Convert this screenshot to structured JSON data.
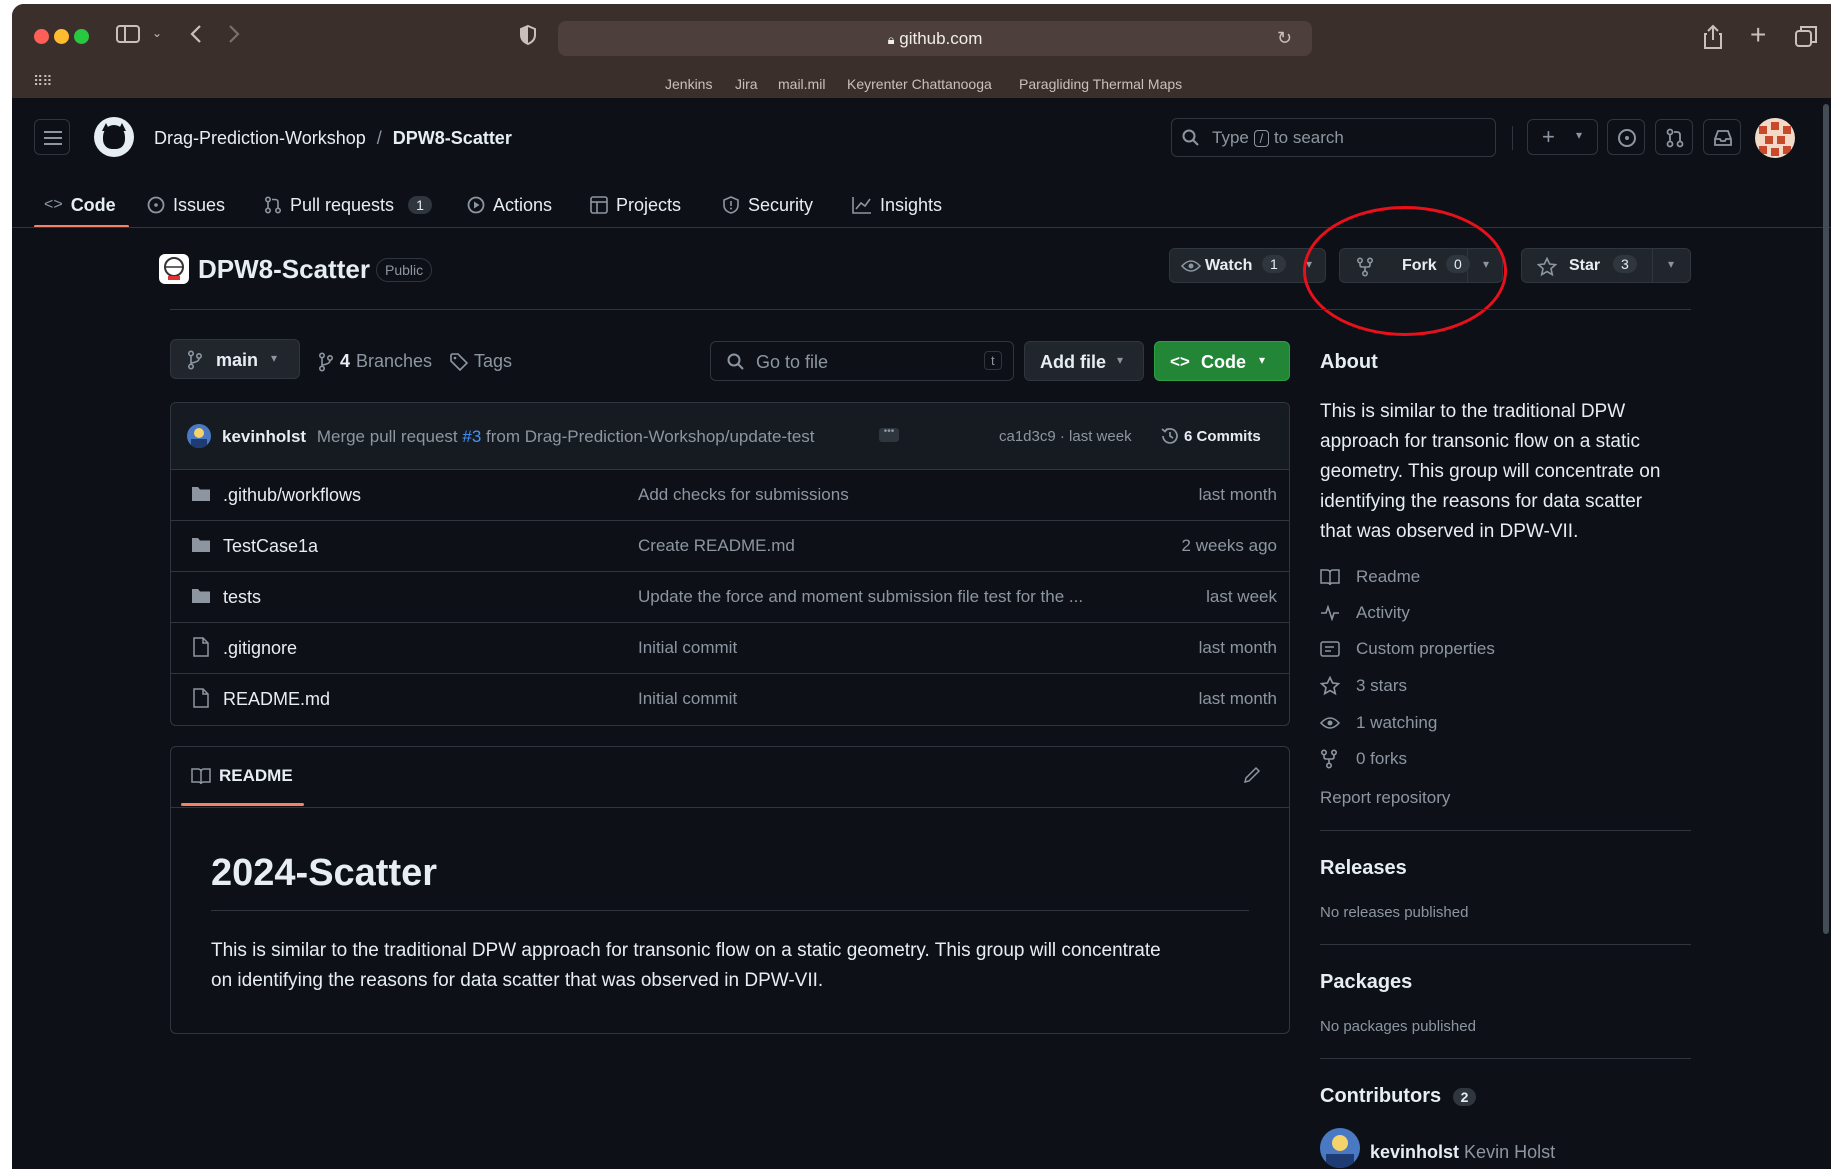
{
  "browser": {
    "url": "github.com",
    "favorites": [
      "Jenkins",
      "Jira",
      "mail.mil",
      "Keyrenter Chattanooga",
      "Paragliding Thermal Maps"
    ]
  },
  "header": {
    "owner": "Drag-Prediction-Workshop",
    "separator": "/",
    "repo": "DPW8-Scatter",
    "search_prefix": "Type",
    "search_key": "/",
    "search_suffix": "to search"
  },
  "nav": {
    "code": "Code",
    "issues": "Issues",
    "pulls": "Pull requests",
    "pulls_count": "1",
    "actions": "Actions",
    "projects": "Projects",
    "security": "Security",
    "insights": "Insights"
  },
  "repo": {
    "name": "DPW8-Scatter",
    "visibility": "Public",
    "watch_label": "Watch",
    "watch_count": "1",
    "fork_label": "Fork",
    "fork_count": "0",
    "star_label": "Star",
    "star_count": "3"
  },
  "toolbar": {
    "branch": "main",
    "branches_count": "4",
    "branches_label": "Branches",
    "tags_label": "Tags",
    "go_to_file": "Go to file",
    "go_to_file_key": "t",
    "add_file": "Add file",
    "code_button": "Code"
  },
  "commit": {
    "author": "kevinholst",
    "message_prefix": "Merge pull request",
    "pr_link": "#3",
    "message_suffix": "from Drag-Prediction-Workshop/update-test",
    "hash_time": "ca1d3c9 · last week",
    "commits_label": "6 Commits"
  },
  "files": [
    {
      "name": ".github/workflows",
      "type": "folder",
      "message": "Add checks for submissions",
      "time": "last month"
    },
    {
      "name": "TestCase1a",
      "type": "folder",
      "message": "Create README.md",
      "time": "2 weeks ago"
    },
    {
      "name": "tests",
      "type": "folder",
      "message": "Update the force and moment submission file test for the ...",
      "time": "last week"
    },
    {
      "name": ".gitignore",
      "type": "file",
      "message": "Initial commit",
      "time": "last month"
    },
    {
      "name": "README.md",
      "type": "file",
      "message": "Initial commit",
      "time": "last month"
    }
  ],
  "readme": {
    "tab_label": "README",
    "heading": "2024-Scatter",
    "body_line1": "This is similar to the traditional DPW approach for transonic flow on a static geometry. This group will concentrate",
    "body_line2": "on identifying the reasons for data scatter that was observed in DPW-VII."
  },
  "about": {
    "title": "About",
    "desc_lines": [
      "This is similar to the traditional DPW",
      "approach for transonic flow on a static",
      "geometry. This group will concentrate on",
      "identifying the reasons for data scatter",
      "that was observed in DPW-VII."
    ],
    "readme": "Readme",
    "activity": "Activity",
    "custom_properties": "Custom properties",
    "stars": "3 stars",
    "watching": "1 watching",
    "forks": "0 forks",
    "report": "Report repository"
  },
  "releases": {
    "title": "Releases",
    "empty": "No releases published"
  },
  "packages": {
    "title": "Packages",
    "empty": "No packages published"
  },
  "contributors": {
    "title": "Contributors",
    "count": "2",
    "first_login": "kevinholst",
    "first_name": "Kevin Holst"
  },
  "colors": {
    "background": "#0d1117",
    "accent_green": "#238636",
    "link_blue": "#4493f8",
    "tab_underline": "#f78166",
    "annotation_red": "#e8101a"
  }
}
